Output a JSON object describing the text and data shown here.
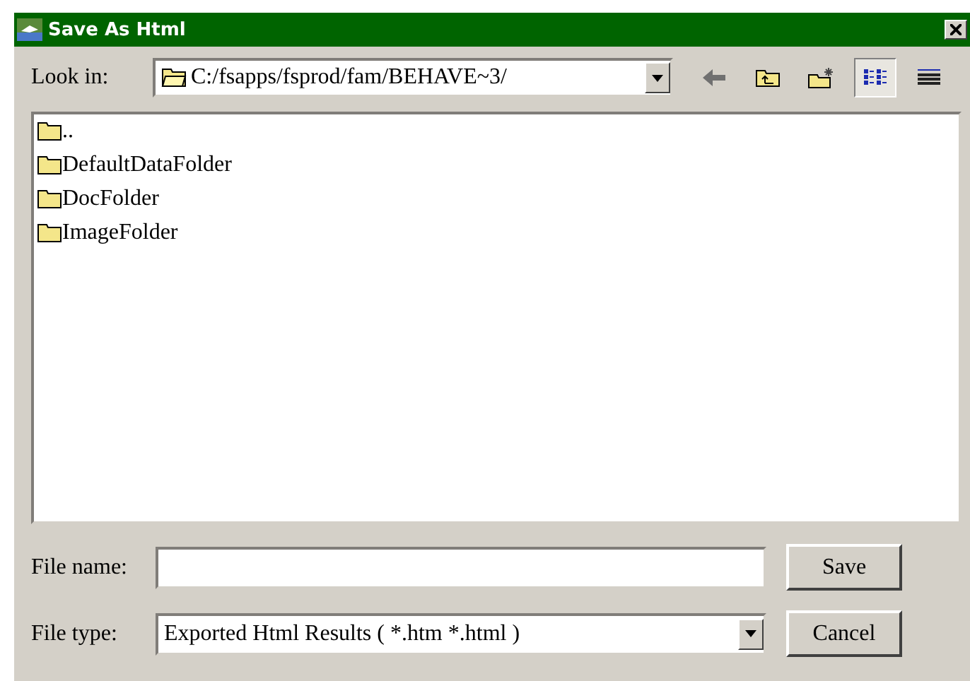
{
  "window": {
    "title": "Save As Html"
  },
  "look_in": {
    "label": "Look in:",
    "value": "C:/fsapps/fsprod/fam/BEHAVE~3/"
  },
  "view_buttons": [
    {
      "kind": "list",
      "selected": true
    },
    {
      "kind": "details",
      "selected": false
    }
  ],
  "files": [
    {
      "name": ".."
    },
    {
      "name": "DefaultDataFolder"
    },
    {
      "name": "DocFolder"
    },
    {
      "name": "ImageFolder"
    }
  ],
  "file_name": {
    "label": "File name:"
  },
  "file_type": {
    "label": "File type:",
    "value": "Exported Html Results ( *.htm *.html )"
  },
  "buttons": [
    {
      "label": "Save"
    },
    {
      "label": "Cancel"
    }
  ]
}
